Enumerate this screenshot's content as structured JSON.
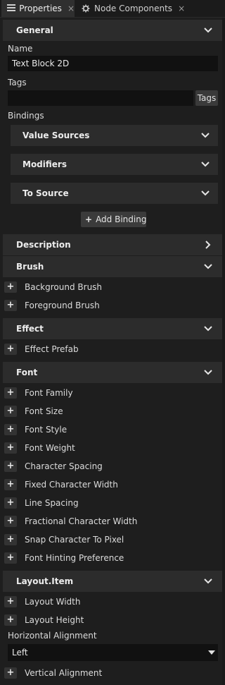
{
  "tabs": [
    {
      "label": "Properties",
      "icon": "list-icon",
      "close": "×"
    },
    {
      "label": "Node Components",
      "icon": "gear-icon",
      "close": "×"
    }
  ],
  "sections": {
    "general": "General",
    "description": "Description",
    "brush": "Brush",
    "effect": "Effect",
    "font": "Font",
    "layout_item": "Layout.Item"
  },
  "fields": {
    "name_label": "Name",
    "name_value": "Text Block 2D",
    "tags_label": "Tags",
    "tags_button": "Tags",
    "bindings_label": "Bindings",
    "horizontal_alignment_label": "Horizontal Alignment",
    "horizontal_alignment_value": "Left"
  },
  "bindings": {
    "subsections": [
      "Value Sources",
      "Modifiers",
      "To Source"
    ],
    "add_binding_plus": "+",
    "add_binding_label": "Add Binding"
  },
  "brush_props": [
    "Background Brush",
    "Foreground Brush"
  ],
  "effect_props": [
    "Effect Prefab"
  ],
  "font_props": [
    "Font Family",
    "Font Size",
    "Font Style",
    "Font Weight",
    "Character Spacing",
    "Fixed Character Width",
    "Line Spacing",
    "Fractional Character Width",
    "Snap Character To Pixel",
    "Font Hinting Preference"
  ],
  "layout_props": [
    "Layout Width",
    "Layout Height"
  ],
  "layout_after_props": [
    "Vertical Alignment"
  ],
  "plus_glyph": "+",
  "colors": {
    "background": "#1e1e1e",
    "header": "#2c2c2c",
    "input": "#111111",
    "button": "#3b3b3b"
  }
}
